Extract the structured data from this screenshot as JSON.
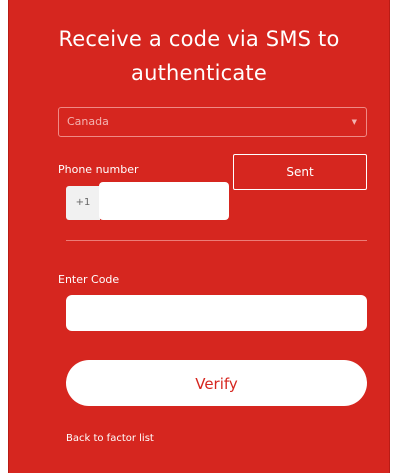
{
  "header": {
    "title_line1": "Receive a code via SMS to",
    "title_line2": "authenticate"
  },
  "country": {
    "selected": "Canada",
    "chevron": "▼"
  },
  "phone": {
    "label": "Phone number",
    "prefix": "+1",
    "value": "",
    "send_label": "Sent"
  },
  "code": {
    "label": "Enter Code",
    "value": ""
  },
  "actions": {
    "verify_label": "Verify",
    "back_label": "Back to factor list"
  },
  "colors": {
    "panel_background": "#d6261f",
    "verify_text": "#d6261f",
    "text_on_panel": "#ffffff"
  }
}
